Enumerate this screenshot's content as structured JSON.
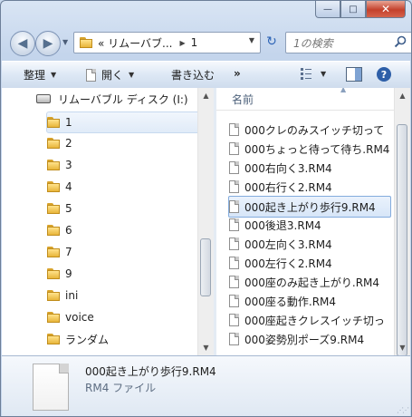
{
  "window": {
    "minimize_label": "—",
    "maximize_label": "□",
    "close_label": "✕"
  },
  "nav": {
    "back_glyph": "◀",
    "forward_glyph": "▶",
    "address_segment": "« リムーバブ...",
    "address_current": "1",
    "refresh_glyph": "↻",
    "search_placeholder": "1の検索"
  },
  "toolbar": {
    "organize_label": "整理",
    "open_label": "開く",
    "burn_label": "書き込む",
    "more_label": "»",
    "help_label": "?"
  },
  "tree": {
    "drive_label": "リムーバブル ディスク (I:)",
    "items": [
      {
        "label": "1",
        "selected": true
      },
      {
        "label": "2"
      },
      {
        "label": "3"
      },
      {
        "label": "4"
      },
      {
        "label": "5"
      },
      {
        "label": "6"
      },
      {
        "label": "7"
      },
      {
        "label": "9"
      },
      {
        "label": "ini"
      },
      {
        "label": "voice"
      },
      {
        "label": "ランダム"
      }
    ]
  },
  "files": {
    "column_name": "名前",
    "items": [
      {
        "label": "000クレのみスイッチ切って"
      },
      {
        "label": "000ちょっと待って待ち.RM4"
      },
      {
        "label": "000右向く3.RM4"
      },
      {
        "label": "000右行く2.RM4"
      },
      {
        "label": "000起き上がり歩行9.RM4",
        "selected": true
      },
      {
        "label": "000後退3.RM4"
      },
      {
        "label": "000左向く3.RM4"
      },
      {
        "label": "000左行く2.RM4"
      },
      {
        "label": "000座のみ起き上がり.RM4"
      },
      {
        "label": "000座る動作.RM4"
      },
      {
        "label": "000座起きクレスイッチ切っ"
      },
      {
        "label": "000姿勢別ポーズ9.RM4"
      }
    ]
  },
  "details": {
    "file_name": "000起き上がり歩行9.RM4",
    "file_type": "RM4 ファイル"
  },
  "colors": {
    "accent": "#2e5fa8",
    "selection_border": "#84acdd",
    "close_button": "#c4412c"
  }
}
